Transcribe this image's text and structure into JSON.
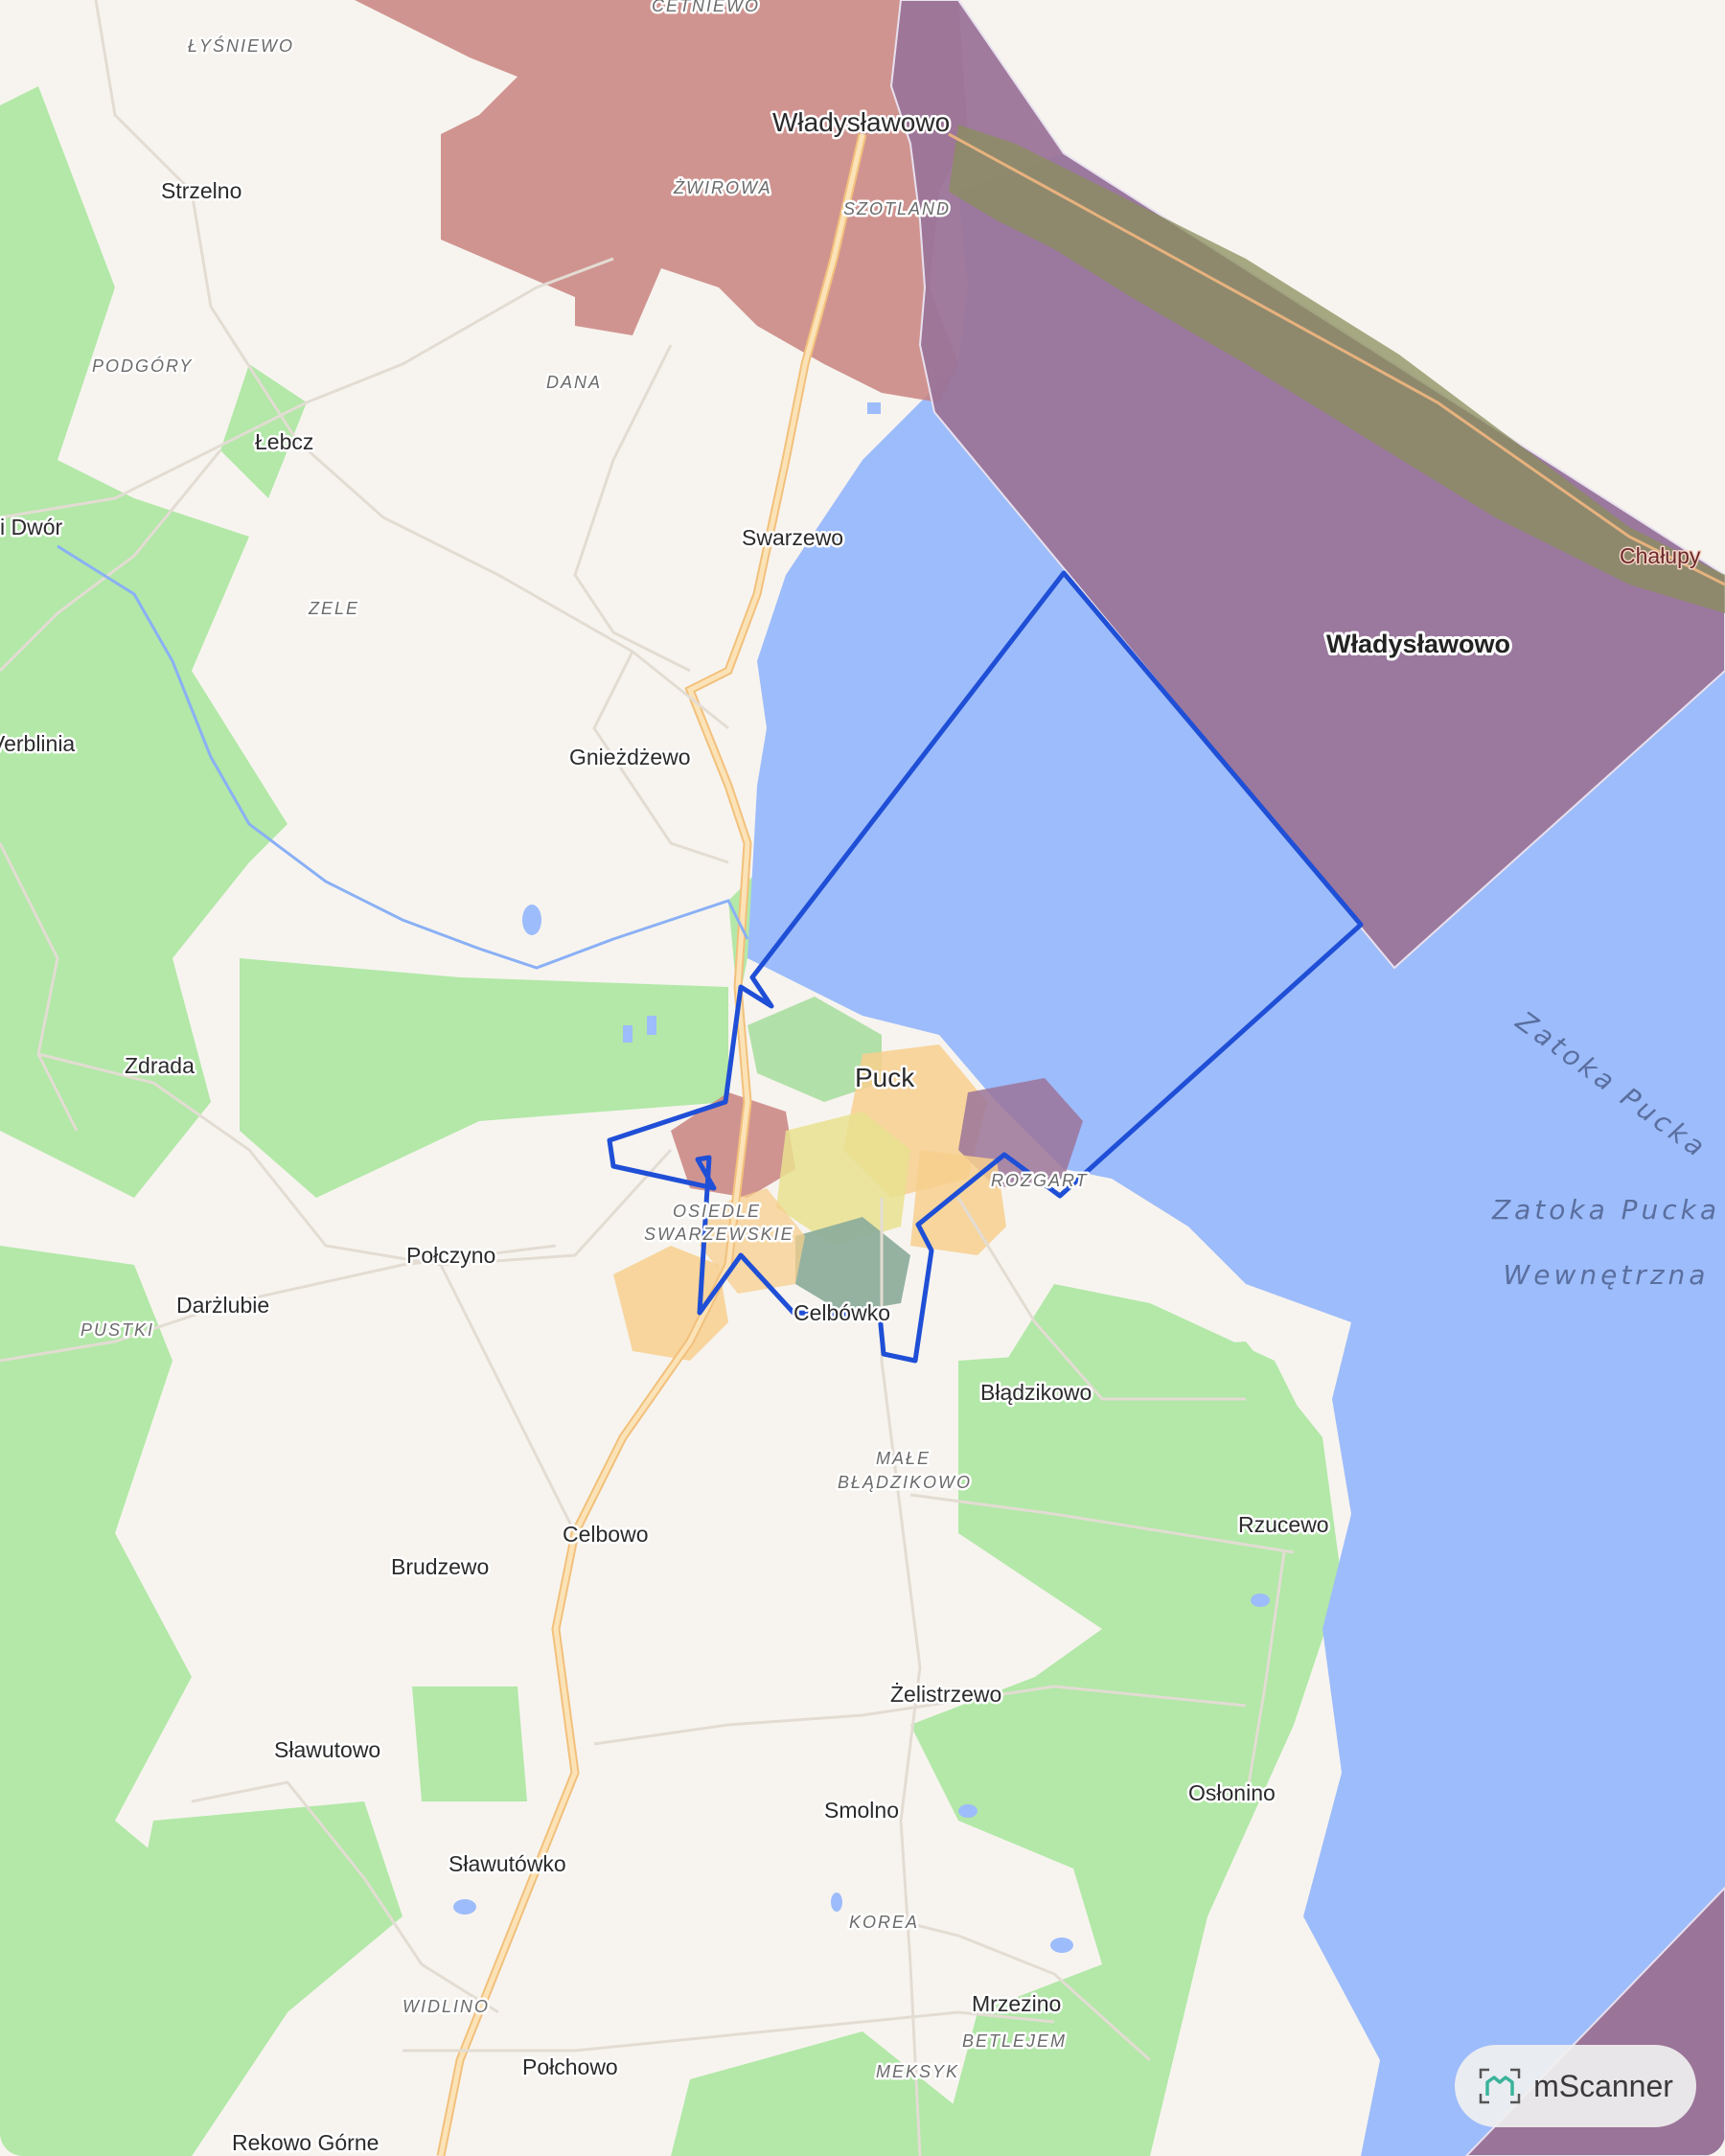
{
  "map": {
    "places": {
      "wladyslawowo": "Władysławowo",
      "cetniewo": "CETNIEWO",
      "lysniewo": "ŁYŚNIEWO",
      "strzelno": "Strzelno",
      "zwirowa": "ŻWIROWA",
      "szotland": "SZOTLAND",
      "podgory": "PODGÓRY",
      "dana": "DANA",
      "lebcz": "Łebcz",
      "nowy_dwor": "i Dwór",
      "swarzewo": "Swarzewo",
      "chalupy": "Chałupy",
      "zele": "ZELE",
      "werblinia": "Verblinia",
      "gniezdzewo": "Gnieżdżewo",
      "zdrada": "Zdrada",
      "puck": "Puck",
      "rozgart": "ROZGART",
      "osiedle_swarzewskie_1": "OSIEDLE",
      "osiedle_swarzewskie_2": "SWARZEWSKIE",
      "polczyno": "Połczyno",
      "darzlubie": "Darżlubie",
      "pustki": "PUSTKI",
      "celbowo_small": "Celbówko",
      "bladzikowo": "Błądzikowo",
      "male_bladzikowo_1": "MAŁE",
      "male_bladzikowo_2": "BŁĄDZIKOWO",
      "celbowo": "Celbowo",
      "brudzewo": "Brudzewo",
      "rzucewo": "Rzucewo",
      "zelistrzewo": "Żelistrzewo",
      "slawutowo": "Sławutowo",
      "smolno": "Smolno",
      "oslonino": "Osłonino",
      "slawutowko": "Sławutówko",
      "korea": "KOREA",
      "widlino": "WIDLINO",
      "mrzezino": "Mrzezino",
      "betlejem": "BETLEJEM",
      "polchowo": "Połchowo",
      "meksyk": "MEKSYK",
      "rekowo_gorne": "Rekowo Górne"
    },
    "water": {
      "zatoka_pucka_1": "Zatoka Pucka",
      "zatoka_pucka_2": "Zatoka Pucka",
      "zatoka_pucka_3": "Wewnętrzna"
    },
    "zones": {
      "wladyslawowo_zone": "Władysławowo"
    },
    "colors": {
      "land": "#f7f4ef",
      "forest": "#b3e8a8",
      "water": "#9dbcfb",
      "zone_red": "#c9827f",
      "zone_purple": "#9b7499",
      "boundary": "#1f4fd6",
      "orange_zone": "#f7cf8e"
    }
  },
  "branding": {
    "logo_text": "mScanner",
    "icon": "mscanner-logo-icon"
  }
}
